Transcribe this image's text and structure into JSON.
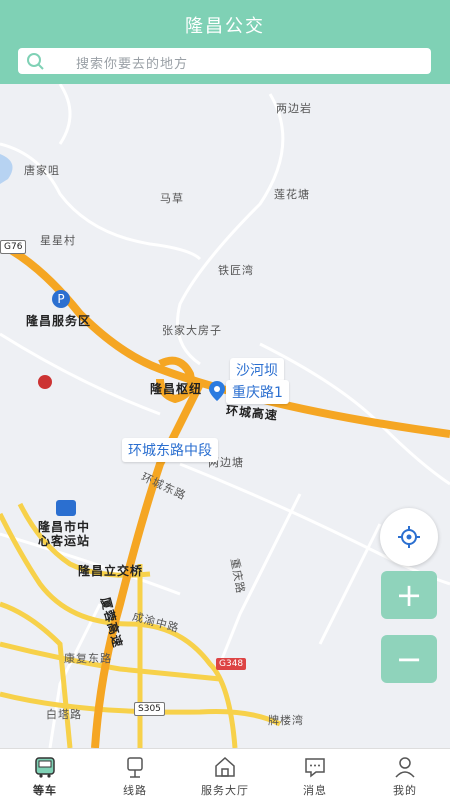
{
  "header": {
    "title": "隆昌公交"
  },
  "search": {
    "placeholder": "搜索你要去的地方"
  },
  "map": {
    "places": {
      "liangbianyan": "两边岩",
      "tangjiaju": "唐家咀",
      "macao": "马草",
      "lianhuatang": "莲花塘",
      "xingxingcun": "星星村",
      "tiejiangwan": "铁匠湾",
      "service_area": "隆昌服务区",
      "zhangjia": "张家大房子",
      "hub": "隆昌枢纽",
      "bus_station": "隆昌市中心客运站",
      "lijiao": "隆昌立交桥",
      "paifang": "牌楼湾",
      "dengbian": "两边塘"
    },
    "roads": {
      "huancheng_gaosu": "环城高速",
      "huancheng_donglu": "环城东路",
      "chongqing_lu": "重庆路",
      "chengyu_zhonglu": "成渝中路",
      "kangfu_donglu": "康复东路",
      "baita_lu": "白塔路",
      "xiarong_gaosu": "厦蓉高速"
    },
    "shields": {
      "g348": "G348",
      "s305": "S305",
      "g76": "G76"
    },
    "callouts": {
      "shahebeng": "沙河坝",
      "chongqinglu1": "重庆路1",
      "huanchengdonglu_mid": "环城东路中段"
    },
    "colors": {
      "highway": "#f5a623",
      "major_road": "#f7d14a",
      "water": "#b7d3f2"
    }
  },
  "controls": {
    "zoom_in": "+",
    "zoom_out": "−"
  },
  "tabs": [
    {
      "label": "等车",
      "icon": "bus-icon"
    },
    {
      "label": "线路",
      "icon": "bus-stop-icon"
    },
    {
      "label": "服务大厅",
      "icon": "home-icon"
    },
    {
      "label": "消息",
      "icon": "message-icon"
    },
    {
      "label": "我的",
      "icon": "user-icon"
    }
  ],
  "colors": {
    "accent": "#7fd1b5"
  }
}
